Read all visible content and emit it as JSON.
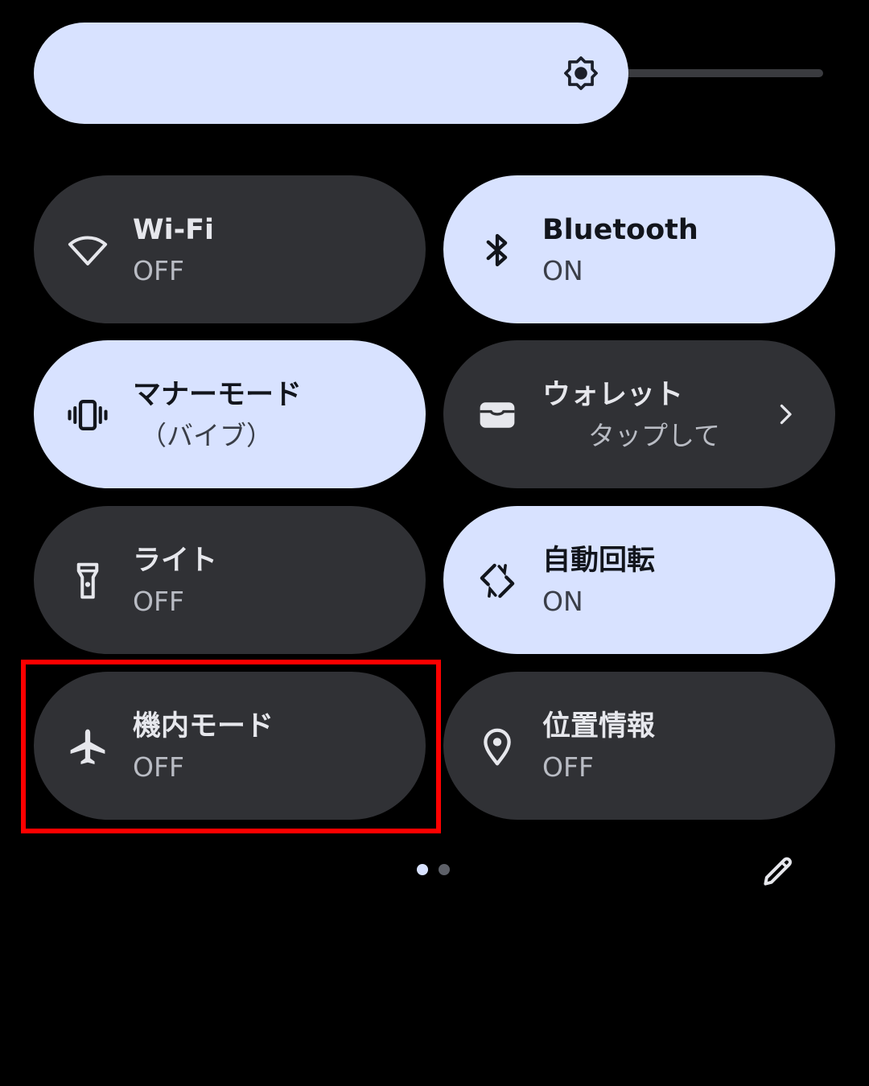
{
  "colors": {
    "background": "#000000",
    "tile_on": "#d8e2ff",
    "tile_off": "#303135",
    "highlight": "#ff0000"
  },
  "brightness": {
    "icon": "brightness-icon",
    "level_percent": 74
  },
  "tiles": [
    {
      "id": "wifi",
      "label": "Wi-Fi",
      "state": "OFF",
      "active": false,
      "icon": "wifi-icon"
    },
    {
      "id": "bluetooth",
      "label": "Bluetooth",
      "state": "ON",
      "active": true,
      "icon": "bluetooth-icon"
    },
    {
      "id": "manner",
      "label": "マナーモード",
      "state": "（バイブ）",
      "active": true,
      "icon": "vibrate-icon"
    },
    {
      "id": "wallet",
      "label": "ウォレット",
      "state": "タップして",
      "active": false,
      "icon": "wallet-icon",
      "has_chevron": true
    },
    {
      "id": "flashlight",
      "label": "ライト",
      "state": "OFF",
      "active": false,
      "icon": "flashlight-icon"
    },
    {
      "id": "autorotate",
      "label": "自動回転",
      "state": "ON",
      "active": true,
      "icon": "rotate-icon"
    },
    {
      "id": "airplane",
      "label": "機内モード",
      "state": "OFF",
      "active": false,
      "icon": "airplane-icon",
      "highlighted": true
    },
    {
      "id": "location",
      "label": "位置情報",
      "state": "OFF",
      "active": false,
      "icon": "location-icon"
    }
  ],
  "pager": {
    "pages": 2,
    "current": 1
  },
  "edit": {
    "icon": "pencil-icon"
  }
}
